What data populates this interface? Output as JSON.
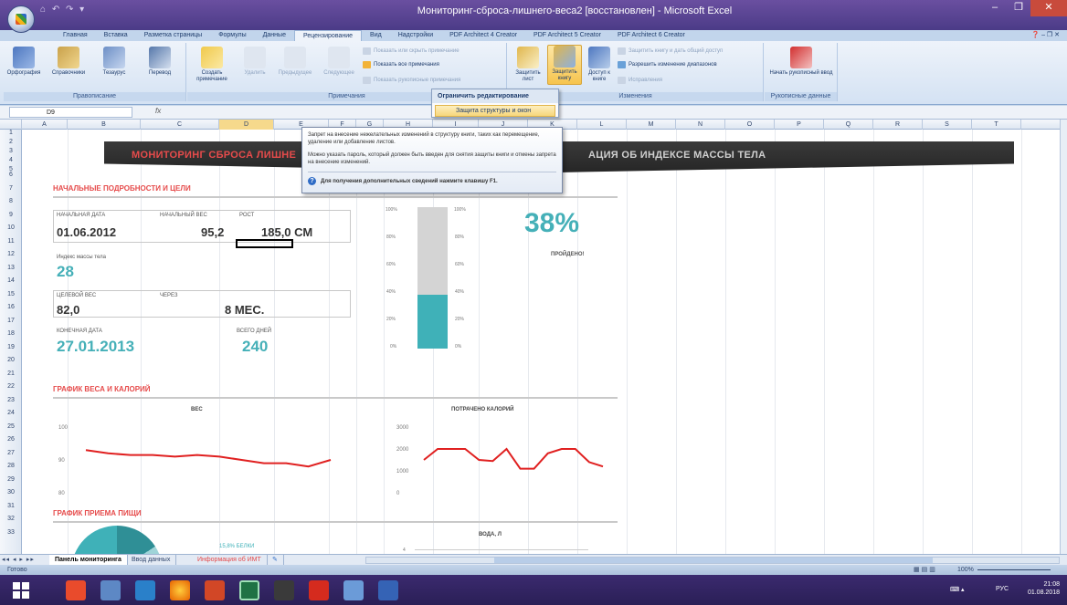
{
  "window": {
    "title": "Мониторинг-сброса-лишнего-веса2 [восстановлен] - Microsoft Excel",
    "qat": "⌂ ↶ ↷ ▾"
  },
  "tabs": [
    "Главная",
    "Вставка",
    "Разметка страницы",
    "Формулы",
    "Данные",
    "Рецензирование",
    "Вид",
    "Надстройки",
    "PDF Architect 4 Creator",
    "PDF Architect 5 Creator",
    "PDF Architect 6 Creator"
  ],
  "ribbon": {
    "proofing": {
      "label": "Правописание",
      "items": [
        "Орфография",
        "Справочники",
        "Тезаурус",
        "Перевод"
      ]
    },
    "comments": {
      "label": "Примечания",
      "create": "Создать примечание",
      "delete": "Удалить",
      "prev": "Предыдущее",
      "next": "Следующее",
      "show_hide": "Показать или скрыть примечание",
      "show_all": "Показать все примечания",
      "show_ink": "Показать рукописные примечания"
    },
    "changes": {
      "label": "Изменения",
      "protect_sheet": "Защитить лист",
      "protect_book": "Защитить книгу",
      "share": "Доступ к книге",
      "protect_share": "Защитить книгу и дать общий доступ",
      "allow_ranges": "Разрешить изменение диапазонов",
      "track": "Исправления"
    },
    "ink": {
      "label": "Рукописные данные",
      "start": "Начать рукописный ввод"
    }
  },
  "dropdown": {
    "header": "Ограничить редактирование",
    "item": "Защита структуры и окон"
  },
  "tooltip": {
    "line1": "Запрет на внесение нежелательных изменений в структуру книги, таких как перемещение, удаление или добавление листов.",
    "line2": "Можно указать пароль, который должен быть введен для снятия защиты книги и отмены запрета на внесение изменений.",
    "hint": "Для получения дополнительных сведений нажмите клавишу F1."
  },
  "formula": {
    "cell": "D9",
    "fx": "fx"
  },
  "columns": [
    "A",
    "B",
    "C",
    "D",
    "E",
    "F",
    "G",
    "H",
    "I",
    "J",
    "K",
    "L",
    "M",
    "N",
    "O",
    "P",
    "Q",
    "R",
    "S",
    "T"
  ],
  "rows": [
    "1",
    "2",
    "3",
    "4",
    "5",
    "6",
    "7",
    "8",
    "9",
    "10",
    "11",
    "12",
    "13",
    "14",
    "15",
    "16",
    "17",
    "18",
    "19",
    "20",
    "21",
    "22",
    "23",
    "24",
    "25",
    "26",
    "27",
    "28",
    "29",
    "30",
    "31",
    "32",
    "33"
  ],
  "dashboard": {
    "banner_left": "МОНИТОРИНГ СБРОСА ЛИШНЕ",
    "banner_right": "АЦИЯ ОБ ИНДЕКСЕ МАССЫ ТЕЛА",
    "section1": "НАЧАЛЬНЫЕ ПОДРОБНОСТИ И ЦЕЛИ",
    "start_date_label": "НАЧАЛЬНАЯ ДАТА",
    "start_date": "01.06.2012",
    "start_weight_label": "НАЧАЛЬНЫЙ ВЕС",
    "start_weight": "95,2",
    "height_label": "РОСТ",
    "height": "185,0 СМ",
    "bmi_label": "Индекс массы тела",
    "bmi": "28",
    "target_label": "ЦЕЛЕВОЙ ВЕС",
    "target": "82,0",
    "through_label": "ЧЕРЕЗ",
    "through": "8 МЕС.",
    "end_date_label": "КОНЕЧНАЯ ДАТА",
    "end_date": "27.01.2013",
    "days_label": "ВСЕГО ДНЕЙ",
    "days": "240",
    "percent": "38%",
    "percent_label": "ПРОЙДЕНО!",
    "progress_fraction": 0.38,
    "section2": "ГРАФИК ВЕСА И КАЛОРИЙ",
    "section3": "ГРАФИК ПРИЕМА ПИЩИ",
    "protein_legend": "15,8% БЕЛКИ"
  },
  "chart_data": [
    {
      "type": "bar",
      "title": "",
      "categories": [
        ""
      ],
      "values": [
        38
      ],
      "ylim": [
        0,
        100
      ],
      "yticks": [
        "100%",
        "80%",
        "60%",
        "40%",
        "20%",
        "0%"
      ],
      "colors": [
        "#3fb1b8",
        "#d4d4d4"
      ]
    },
    {
      "type": "line",
      "title": "ВЕС",
      "x": [
        1,
        2,
        3,
        4,
        5,
        6,
        7,
        8,
        9,
        10,
        11,
        12
      ],
      "values": [
        93,
        92,
        91.5,
        91.5,
        91,
        91.5,
        91,
        90,
        89,
        89,
        88,
        90
      ],
      "ylim": [
        80,
        100
      ],
      "yticks": [
        "100",
        "90",
        "80"
      ],
      "color": "#e02020"
    },
    {
      "type": "line",
      "title": "ПОТРАЧЕНО КАЛОРИЙ",
      "x": [
        1,
        2,
        3,
        4,
        5,
        6,
        7,
        8,
        9,
        10,
        11,
        12,
        13,
        14
      ],
      "values": [
        1500,
        2000,
        2000,
        2000,
        1500,
        1450,
        2000,
        1100,
        1100,
        1800,
        2000,
        2000,
        1400,
        1200
      ],
      "ylim": [
        0,
        3000
      ],
      "yticks": [
        "3000",
        "2000",
        "1000",
        "0"
      ],
      "color": "#e02020"
    },
    {
      "type": "pie",
      "title": "",
      "series": [
        {
          "name": "БЕЛКИ",
          "values": [
            15.8
          ]
        }
      ]
    },
    {
      "type": "line",
      "title": "ВОДА, Л",
      "values": [],
      "yticks": [
        "4"
      ]
    }
  ],
  "sheets": [
    "Панель мониторинга",
    "Ввод данных",
    "Информация об ИМТ"
  ],
  "status": {
    "ready": "Готово",
    "zoom": "100%"
  },
  "taskbar": {
    "lang": "РУС",
    "time": "21:08",
    "date": "01.08.2018"
  }
}
